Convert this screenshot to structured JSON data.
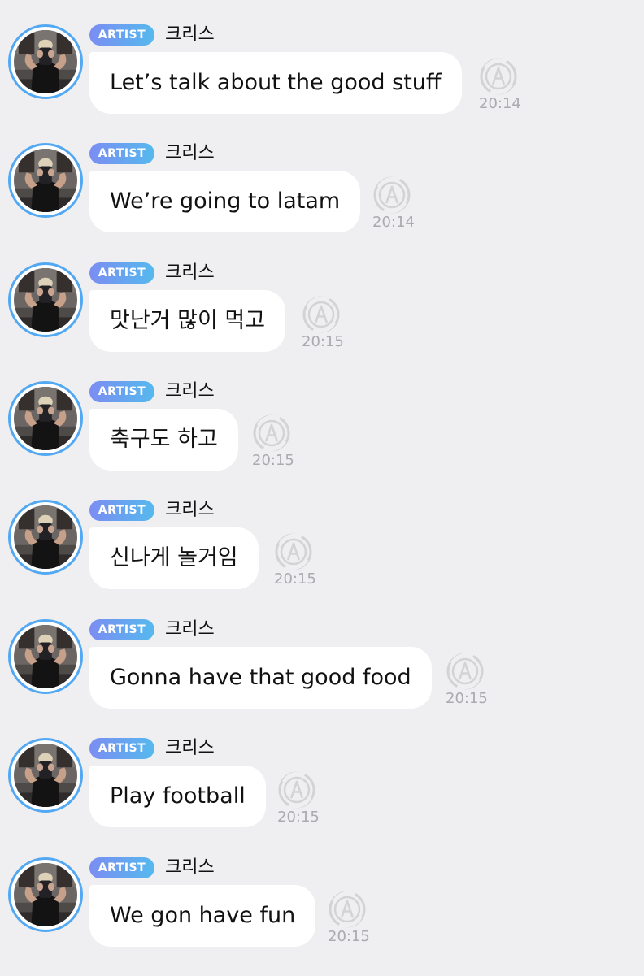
{
  "chat": {
    "sender_badge": "ARTIST",
    "sender_name": "크리스",
    "translate_icon": "circular-translate-A-icon",
    "avatar_ring_color": "#52a8f2",
    "badge_gradient": [
      "#7b8df2",
      "#55b9ee"
    ],
    "messages": [
      {
        "text": "Let’s talk about the good stuff",
        "time": "20:14"
      },
      {
        "text": "We’re going to latam",
        "time": "20:14"
      },
      {
        "text": "맛난거 많이 먹고",
        "time": "20:15"
      },
      {
        "text": "축구도 하고",
        "time": "20:15"
      },
      {
        "text": "신나게 놀거임",
        "time": "20:15"
      },
      {
        "text": "Gonna have that good food",
        "time": "20:15"
      },
      {
        "text": "Play football",
        "time": "20:15"
      },
      {
        "text": "We gon have fun",
        "time": "20:15"
      }
    ]
  }
}
